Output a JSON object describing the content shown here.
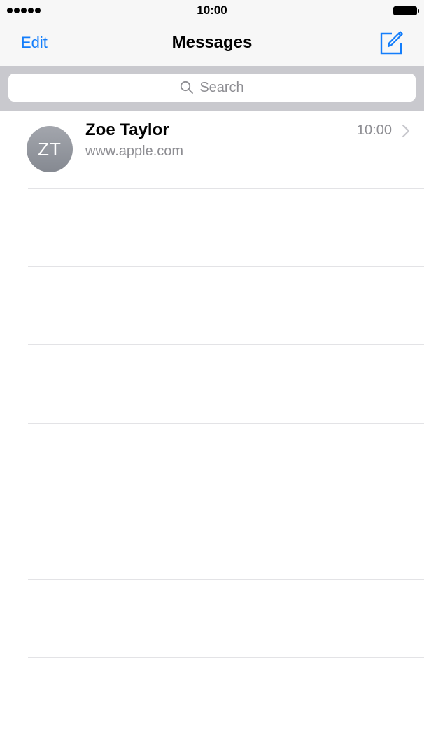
{
  "status_bar": {
    "time": "10:00",
    "signal_icon": "signal-dots-icon",
    "battery_icon": "battery-icon"
  },
  "nav": {
    "edit_label": "Edit",
    "title": "Messages",
    "compose_icon": "compose-icon"
  },
  "search": {
    "placeholder": "Search",
    "icon": "search-icon"
  },
  "conversations": [
    {
      "initials": "ZT",
      "name": "Zoe Taylor",
      "preview": "www.apple.com",
      "time": "10:00",
      "chevron_icon": "chevron-right-icon"
    }
  ],
  "colors": {
    "accent": "#147efb",
    "secondary_text": "#8e8e93",
    "bar_background": "#f7f7f7",
    "search_background": "#c9c9ce",
    "separator": "#e3e3e6"
  }
}
